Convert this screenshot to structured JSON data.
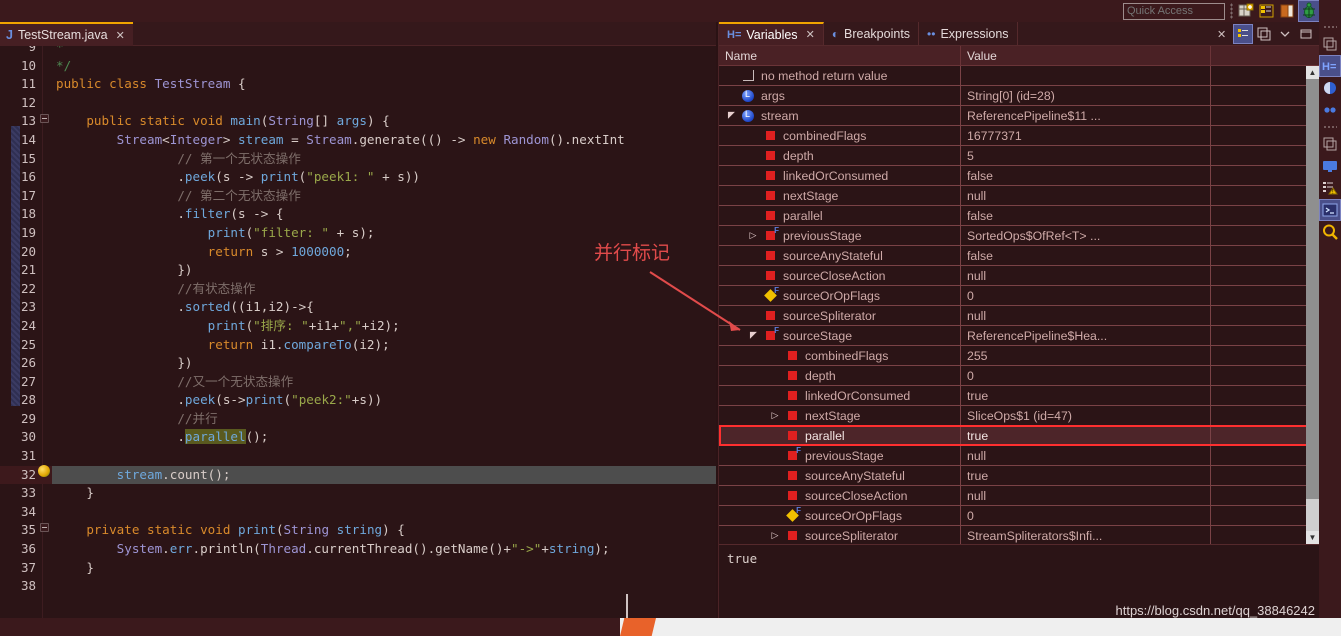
{
  "topbar": {
    "quick_access_placeholder": "Quick Access",
    "icons": [
      {
        "name": "new-wizard-icon",
        "glyph": "▦"
      },
      {
        "name": "java-perspective-icon",
        "glyph": "⛁"
      },
      {
        "name": "open-perspective-icon",
        "glyph": "◨"
      },
      {
        "name": "debug-perspective-icon",
        "glyph": "🐞"
      },
      {
        "name": "java-ee-perspective-icon",
        "glyph": "⟳"
      }
    ]
  },
  "editor": {
    "tab": {
      "icon": "J",
      "label": "TestStream.java",
      "close": "✕"
    },
    "lines": [
      {
        "num": "9",
        "marker": "",
        "indent": 1,
        "tokens": [
          {
            "c": "cmtdoc",
            "t": "*"
          }
        ]
      },
      {
        "num": "10",
        "marker": "",
        "indent": 1,
        "tokens": [
          {
            "c": "cmtdoc",
            "t": "*/"
          }
        ]
      },
      {
        "num": "11",
        "marker": "",
        "indent": 0,
        "tokens": [
          {
            "c": "kw",
            "t": "public "
          },
          {
            "c": "kw",
            "t": "class "
          },
          {
            "c": "typ",
            "t": "TestStream"
          },
          {
            "c": "plain",
            "t": " {"
          }
        ]
      },
      {
        "num": "12",
        "marker": "",
        "indent": 0,
        "tokens": []
      },
      {
        "num": "13",
        "marker": "collapse",
        "indent": 0,
        "tokens": [
          {
            "c": "plain",
            "t": "    "
          },
          {
            "c": "kw",
            "t": "public "
          },
          {
            "c": "kw",
            "t": "static "
          },
          {
            "c": "kw",
            "t": "void "
          },
          {
            "c": "mth",
            "t": "main"
          },
          {
            "c": "plain",
            "t": "("
          },
          {
            "c": "typ",
            "t": "String"
          },
          {
            "c": "plain",
            "t": "[] "
          },
          {
            "c": "num2",
            "t": "args"
          },
          {
            "c": "plain",
            "t": ") {"
          }
        ]
      },
      {
        "num": "14",
        "marker": "",
        "indent": 0,
        "tokens": [
          {
            "c": "plain",
            "t": "        "
          },
          {
            "c": "typ",
            "t": "Stream"
          },
          {
            "c": "plain",
            "t": "<"
          },
          {
            "c": "typ",
            "t": "Integer"
          },
          {
            "c": "plain",
            "t": "> "
          },
          {
            "c": "num2",
            "t": "stream"
          },
          {
            "c": "plain",
            "t": " = "
          },
          {
            "c": "typ",
            "t": "Stream"
          },
          {
            "c": "plain",
            "t": ".generate(() -> "
          },
          {
            "c": "kw",
            "t": "new "
          },
          {
            "c": "typ",
            "t": "Random"
          },
          {
            "c": "plain",
            "t": "().nextInt"
          }
        ]
      },
      {
        "num": "15",
        "marker": "",
        "indent": 0,
        "tokens": [
          {
            "c": "cmt",
            "t": "                // 第一个无状态操作"
          }
        ]
      },
      {
        "num": "16",
        "marker": "",
        "indent": 0,
        "tokens": [
          {
            "c": "plain",
            "t": "                ."
          },
          {
            "c": "mth",
            "t": "peek"
          },
          {
            "c": "plain",
            "t": "(s -> "
          },
          {
            "c": "mth",
            "t": "print"
          },
          {
            "c": "plain",
            "t": "("
          },
          {
            "c": "str",
            "t": "\"peek1: \""
          },
          {
            "c": "plain",
            "t": " + s))"
          }
        ]
      },
      {
        "num": "17",
        "marker": "",
        "indent": 0,
        "tokens": [
          {
            "c": "cmt",
            "t": "                // 第二个无状态操作"
          }
        ]
      },
      {
        "num": "18",
        "marker": "",
        "indent": 0,
        "tokens": [
          {
            "c": "plain",
            "t": "                ."
          },
          {
            "c": "mth",
            "t": "filter"
          },
          {
            "c": "plain",
            "t": "(s -> {"
          }
        ]
      },
      {
        "num": "19",
        "marker": "",
        "indent": 0,
        "tokens": [
          {
            "c": "plain",
            "t": "                    "
          },
          {
            "c": "mth",
            "t": "print"
          },
          {
            "c": "plain",
            "t": "("
          },
          {
            "c": "str",
            "t": "\"filter: \""
          },
          {
            "c": "plain",
            "t": " + s);"
          }
        ]
      },
      {
        "num": "20",
        "marker": "",
        "indent": 0,
        "tokens": [
          {
            "c": "plain",
            "t": "                    "
          },
          {
            "c": "kw",
            "t": "return "
          },
          {
            "c": "plain",
            "t": "s > "
          },
          {
            "c": "num2",
            "t": "1000000"
          },
          {
            "c": "plain",
            "t": ";"
          }
        ]
      },
      {
        "num": "21",
        "marker": "",
        "indent": 0,
        "tokens": [
          {
            "c": "plain",
            "t": "                })"
          }
        ]
      },
      {
        "num": "22",
        "marker": "",
        "indent": 0,
        "tokens": [
          {
            "c": "cmt",
            "t": "                //有状态操作"
          }
        ]
      },
      {
        "num": "23",
        "marker": "",
        "indent": 0,
        "tokens": [
          {
            "c": "plain",
            "t": "                ."
          },
          {
            "c": "mth",
            "t": "sorted"
          },
          {
            "c": "plain",
            "t": "((i1,i2)->{"
          }
        ]
      },
      {
        "num": "24",
        "marker": "",
        "indent": 0,
        "tokens": [
          {
            "c": "plain",
            "t": "                    "
          },
          {
            "c": "mth",
            "t": "print"
          },
          {
            "c": "plain",
            "t": "("
          },
          {
            "c": "str",
            "t": "\"排序: \""
          },
          {
            "c": "plain",
            "t": "+i1+"
          },
          {
            "c": "str",
            "t": "\",\""
          },
          {
            "c": "plain",
            "t": "+i2);"
          }
        ]
      },
      {
        "num": "25",
        "marker": "",
        "indent": 0,
        "tokens": [
          {
            "c": "plain",
            "t": "                    "
          },
          {
            "c": "kw",
            "t": "return "
          },
          {
            "c": "plain",
            "t": "i1."
          },
          {
            "c": "mth",
            "t": "compareTo"
          },
          {
            "c": "plain",
            "t": "(i2);"
          }
        ]
      },
      {
        "num": "26",
        "marker": "",
        "indent": 0,
        "tokens": [
          {
            "c": "plain",
            "t": "                })"
          }
        ]
      },
      {
        "num": "27",
        "marker": "",
        "indent": 0,
        "tokens": [
          {
            "c": "cmt",
            "t": "                //又一个无状态操作"
          }
        ]
      },
      {
        "num": "28",
        "marker": "",
        "indent": 0,
        "tokens": [
          {
            "c": "plain",
            "t": "                ."
          },
          {
            "c": "mth",
            "t": "peek"
          },
          {
            "c": "plain",
            "t": "(s->"
          },
          {
            "c": "mth",
            "t": "print"
          },
          {
            "c": "plain",
            "t": "("
          },
          {
            "c": "str",
            "t": "\"peek2:\""
          },
          {
            "c": "plain",
            "t": "+s))"
          }
        ]
      },
      {
        "num": "29",
        "marker": "",
        "indent": 0,
        "tokens": [
          {
            "c": "cmt",
            "t": "                //并行"
          }
        ]
      },
      {
        "num": "30",
        "marker": "",
        "indent": 0,
        "tokens": [
          {
            "c": "plain",
            "t": "                ."
          },
          {
            "c": "hlword mth",
            "t": "parallel"
          },
          {
            "c": "plain",
            "t": "();"
          }
        ]
      },
      {
        "num": "31",
        "marker": "",
        "indent": 0,
        "tokens": []
      },
      {
        "num": "32",
        "marker": "current",
        "indent": 0,
        "highlight": true,
        "tokens": [
          {
            "c": "plain",
            "t": "        "
          },
          {
            "c": "mth",
            "t": "stream"
          },
          {
            "c": "plain",
            "t": ".count();"
          }
        ]
      },
      {
        "num": "33",
        "marker": "",
        "indent": 0,
        "tokens": [
          {
            "c": "plain",
            "t": "    }"
          }
        ]
      },
      {
        "num": "34",
        "marker": "",
        "indent": 0,
        "tokens": []
      },
      {
        "num": "35",
        "marker": "collapse",
        "indent": 0,
        "tokens": [
          {
            "c": "plain",
            "t": "    "
          },
          {
            "c": "kw",
            "t": "private "
          },
          {
            "c": "kw",
            "t": "static "
          },
          {
            "c": "kw",
            "t": "void "
          },
          {
            "c": "mth",
            "t": "print"
          },
          {
            "c": "plain",
            "t": "("
          },
          {
            "c": "typ",
            "t": "String"
          },
          {
            "c": "plain",
            "t": " "
          },
          {
            "c": "num2",
            "t": "string"
          },
          {
            "c": "plain",
            "t": ") {"
          }
        ]
      },
      {
        "num": "36",
        "marker": "",
        "indent": 0,
        "tokens": [
          {
            "c": "plain",
            "t": "        "
          },
          {
            "c": "typ",
            "t": "System"
          },
          {
            "c": "plain",
            "t": "."
          },
          {
            "c": "num2",
            "t": "err"
          },
          {
            "c": "plain",
            "t": ".println("
          },
          {
            "c": "typ",
            "t": "Thread"
          },
          {
            "c": "plain",
            "t": ".currentThread().getName()+"
          },
          {
            "c": "str",
            "t": "\"->\""
          },
          {
            "c": "plain",
            "t": "+"
          },
          {
            "c": "num2",
            "t": "string"
          },
          {
            "c": "plain",
            "t": ");"
          }
        ]
      },
      {
        "num": "37",
        "marker": "",
        "indent": 0,
        "tokens": [
          {
            "c": "plain",
            "t": "    }"
          }
        ]
      },
      {
        "num": "38",
        "marker": "",
        "indent": 0,
        "tokens": []
      }
    ]
  },
  "debug_panel": {
    "tabs": [
      {
        "name": "variables",
        "label": "Variables",
        "icon": "H=",
        "active": true,
        "closable": true
      },
      {
        "name": "breakpoints",
        "label": "Breakpoints",
        "icon": "◐",
        "active": false,
        "closable": false
      },
      {
        "name": "expressions",
        "label": "Expressions",
        "icon": "••",
        "active": false,
        "closable": false
      }
    ],
    "toolbar_icons": [
      {
        "name": "remove-all-icon",
        "glyph": "✕"
      },
      {
        "name": "show-logical-structure-icon",
        "glyph": "⊞",
        "selected": true
      },
      {
        "name": "collapse-all-icon",
        "glyph": "⧉"
      },
      {
        "name": "view-menu-icon",
        "glyph": "⌄"
      },
      {
        "name": "minimize-icon",
        "glyph": "▭"
      }
    ],
    "columns": [
      "Name",
      "Value"
    ],
    "rows": [
      {
        "indent": 0,
        "twisty": "",
        "icon": "return",
        "name": "no method return value",
        "value": ""
      },
      {
        "indent": 0,
        "twisty": "",
        "icon": "local",
        "name": "args",
        "value": "String[0]  (id=28)"
      },
      {
        "indent": 0,
        "twisty": "open",
        "icon": "local",
        "name": "stream",
        "value": "ReferencePipeline$11  ..."
      },
      {
        "indent": 1,
        "twisty": "",
        "icon": "field",
        "name": "combinedFlags",
        "value": "16777371"
      },
      {
        "indent": 1,
        "twisty": "",
        "icon": "field",
        "name": "depth",
        "value": "5"
      },
      {
        "indent": 1,
        "twisty": "",
        "icon": "field",
        "name": "linkedOrConsumed",
        "value": "false"
      },
      {
        "indent": 1,
        "twisty": "",
        "icon": "field",
        "name": "nextStage",
        "value": "null"
      },
      {
        "indent": 1,
        "twisty": "",
        "icon": "field",
        "name": "parallel",
        "value": "false"
      },
      {
        "indent": 1,
        "twisty": "closed",
        "icon": "field-f",
        "name": "previousStage",
        "value": "SortedOps$OfRef<T> ..."
      },
      {
        "indent": 1,
        "twisty": "",
        "icon": "field",
        "name": "sourceAnyStateful",
        "value": "false"
      },
      {
        "indent": 1,
        "twisty": "",
        "icon": "field",
        "name": "sourceCloseAction",
        "value": "null"
      },
      {
        "indent": 1,
        "twisty": "",
        "icon": "static-f",
        "name": "sourceOrOpFlags",
        "value": "0"
      },
      {
        "indent": 1,
        "twisty": "",
        "icon": "field",
        "name": "sourceSpliterator",
        "value": "null"
      },
      {
        "indent": 1,
        "twisty": "open",
        "icon": "field-f",
        "name": "sourceStage",
        "value": "ReferencePipeline$Hea..."
      },
      {
        "indent": 2,
        "twisty": "",
        "icon": "field",
        "name": "combinedFlags",
        "value": "255"
      },
      {
        "indent": 2,
        "twisty": "",
        "icon": "field",
        "name": "depth",
        "value": "0"
      },
      {
        "indent": 2,
        "twisty": "",
        "icon": "field",
        "name": "linkedOrConsumed",
        "value": "true"
      },
      {
        "indent": 2,
        "twisty": "closed",
        "icon": "field",
        "name": "nextStage",
        "value": "SliceOps$1  (id=47)"
      },
      {
        "indent": 2,
        "twisty": "",
        "icon": "field",
        "name": "parallel",
        "value": "true",
        "selected": true,
        "boxed": true
      },
      {
        "indent": 2,
        "twisty": "",
        "icon": "field-f",
        "name": "previousStage",
        "value": "null"
      },
      {
        "indent": 2,
        "twisty": "",
        "icon": "field",
        "name": "sourceAnyStateful",
        "value": "true"
      },
      {
        "indent": 2,
        "twisty": "",
        "icon": "field",
        "name": "sourceCloseAction",
        "value": "null"
      },
      {
        "indent": 2,
        "twisty": "",
        "icon": "static-f",
        "name": "sourceOrOpFlags",
        "value": "0"
      },
      {
        "indent": 2,
        "twisty": "closed",
        "icon": "field",
        "name": "sourceSpliterator",
        "value": "StreamSpliterators$Infi..."
      }
    ],
    "detail_value": "true"
  },
  "rail": {
    "icons": [
      {
        "name": "restore-icon",
        "glyph": "⧉"
      },
      {
        "name": "variables-view-icon",
        "glyph": "H=",
        "selected": true
      },
      {
        "name": "breakpoints-view-icon",
        "glyph": "◐"
      },
      {
        "name": "expressions-view-icon",
        "glyph": "••"
      },
      {
        "name": "restore-2-icon",
        "glyph": "⧉"
      },
      {
        "name": "console-view-icon",
        "glyph": "🖵"
      },
      {
        "name": "problems-view-icon",
        "glyph": "⚠"
      },
      {
        "name": "terminal-view-icon",
        "glyph": "▶_"
      },
      {
        "name": "search-view-icon",
        "glyph": "🔍"
      }
    ]
  },
  "annotations": [
    {
      "name": "parallel-flag-annotation",
      "text": "并行标记"
    }
  ],
  "watermark": {
    "text": "https://blog.csdn.net/qq_38846242"
  },
  "colors": {
    "accent": "#f0a500",
    "annotation_red": "#e14b4b",
    "selection_blue": "#4a4f8a",
    "panel_bg": "#2b1416"
  }
}
